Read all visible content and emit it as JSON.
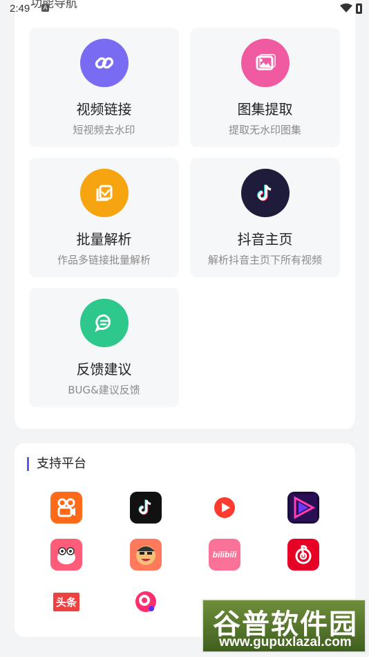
{
  "status_bar": {
    "time": "2:49",
    "a_badge": "A",
    "page_title_partial": "功能导航"
  },
  "tiles": [
    {
      "title": "视频链接",
      "subtitle": "短视频去水印",
      "icon": "link-icon",
      "color": "#7a6cf2"
    },
    {
      "title": "图集提取",
      "subtitle": "提取无水印图集",
      "icon": "image-icon",
      "color": "#ef5aa0"
    },
    {
      "title": "批量解析",
      "subtitle": "作品多链接批量解析",
      "icon": "batch-copy-icon",
      "color": "#f6a511"
    },
    {
      "title": "抖音主页",
      "subtitle": "解析抖音主页下所有视频",
      "icon": "douyin-icon",
      "color": "#1f1b3a"
    },
    {
      "title": "反馈建议",
      "subtitle": "BUG&建议反馈",
      "icon": "feedback-icon",
      "color": "#2ec78c"
    }
  ],
  "platforms": {
    "title": "支持平台",
    "items": [
      {
        "name": "kuaishou-app-icon"
      },
      {
        "name": "douyin-app-icon"
      },
      {
        "name": "youtube-style-app-icon"
      },
      {
        "name": "weishi-app-icon"
      },
      {
        "name": "pipixia-app-icon"
      },
      {
        "name": "zuiyou-app-icon"
      },
      {
        "name": "bilibili-app-icon",
        "text": "bilibili"
      },
      {
        "name": "netease-music-app-icon"
      },
      {
        "name": "toutiao-app-icon",
        "text": "头条"
      },
      {
        "name": "quanmin-app-icon"
      }
    ]
  },
  "watermark": {
    "main": "谷普软件园",
    "url": "www.gupuxlazal.com"
  }
}
